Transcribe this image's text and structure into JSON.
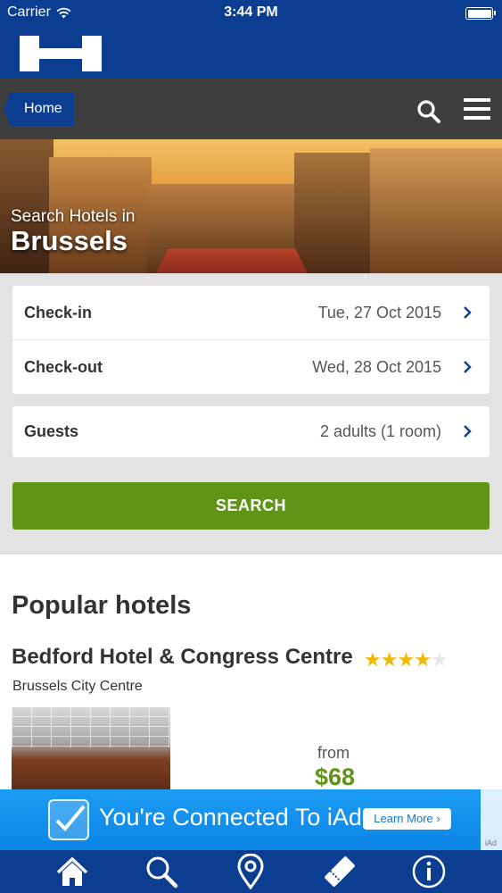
{
  "status_bar": {
    "carrier": "Carrier",
    "time": "3:44 PM"
  },
  "brand": {
    "logo_icon": "hotels-h-logo-icon"
  },
  "navbar": {
    "home_label": "Home",
    "search_icon": "search-icon",
    "menu_icon": "hamburger-menu-icon"
  },
  "hero": {
    "line1": "Search Hotels in",
    "city": "Brussels"
  },
  "form": {
    "checkin": {
      "label": "Check-in",
      "value": "Tue, 27 Oct 2015"
    },
    "checkout": {
      "label": "Check-out",
      "value": "Wed, 28 Oct 2015"
    },
    "guests": {
      "label": "Guests",
      "value": "2 adults (1 room)"
    },
    "search_label": "SEARCH"
  },
  "popular": {
    "title": "Popular hotels",
    "hotels": [
      {
        "name": "Bedford Hotel & Congress Centre",
        "stars": 4,
        "max_stars": 5,
        "location": "Brussels City Centre",
        "from_label": "from",
        "price": "$68"
      }
    ]
  },
  "ad": {
    "message": "You're Connected To iAd",
    "button": "Learn More ›",
    "tag": "iAd"
  },
  "tabbar": {
    "icons": [
      "home-icon",
      "search-icon",
      "map-pin-icon",
      "ticket-icon",
      "info-icon"
    ]
  },
  "colors": {
    "brand_blue": "#0b3d91",
    "nav_dark": "#3e3e3e",
    "accent_green": "#5f9416",
    "star_gold": "#f5b800",
    "ad_blue": "#0c84e4"
  }
}
